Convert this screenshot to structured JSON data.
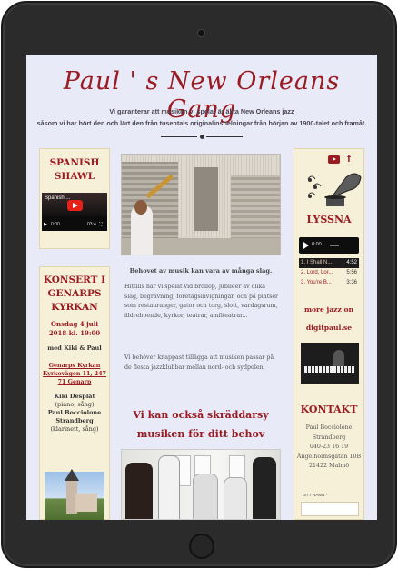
{
  "site": {
    "title": "Paul ' s New Orleans Gang",
    "intro_line1": "Vi garanterar att musiken vi spelar är äkta New Orleans jazz",
    "intro_line2": "såsom vi har hört den och lärt den från tusentals originalinspelningar från början av 1900-talet och framåt."
  },
  "left": {
    "video_title": "SPANISH SHAWL",
    "video_label": "Spanish ...",
    "video_time_start": "0:00",
    "video_time_end": "03:4",
    "concert_title": "KONSERT I GENARPS KYRKAN",
    "concert_date": "Onsdag 4 juli 2018 kl. 19:00",
    "concert_with": "med Kiki & Paul",
    "concert_address": "Genarps Kyrkan Kyrkovägen 11, 247 71 Genarp",
    "performer1_name": "Kiki Desplat",
    "performer1_role": "(piano, sång)",
    "performer2_name": "Paul Bocciolone Strandberg",
    "performer2_role": "(klarinett, sång)"
  },
  "middle": {
    "caption": "Behovet av musik kan vara av många slag.",
    "para1": "Hittills har vi spelat vid bröllop, jubileer av olika slag, begravning, företagsinvigningar, och på platser som restauranger, gator och torg, slott, vardagsrum, äldreboende, kyrkor, teatrar, amfiteatrar...",
    "para2": "Vi behöver knappast tillägga att musiken passar på de flesta jazzklubbar mellan nord- och sydpolen.",
    "headline": "Vi kan också skräddarsy musiken för ditt behov"
  },
  "right": {
    "listen_title": "LYSSNA",
    "audio_time": "0:00",
    "tracks": [
      {
        "label": "1. I Shall N...",
        "duration": "4:52"
      },
      {
        "label": "2. Lord, Lor...",
        "duration": "5:56"
      },
      {
        "label": "3. You're B...",
        "duration": "3:36"
      }
    ],
    "more_jazz": "more jazz on",
    "more_jazz_site": "digitpaul.se",
    "contact_title": "KONTAKT",
    "contact_name": "Paul Bocciolone Strandberg",
    "contact_phone": "040-23 16 19",
    "contact_street": "Ängelholmsgatan 10B",
    "contact_city": "21422 Malmö",
    "name_label": "DITT NAMN",
    "name_required": "*"
  },
  "colors": {
    "accent": "#9b1b22",
    "background": "#e8eaf8",
    "card": "#f7f0d8"
  }
}
